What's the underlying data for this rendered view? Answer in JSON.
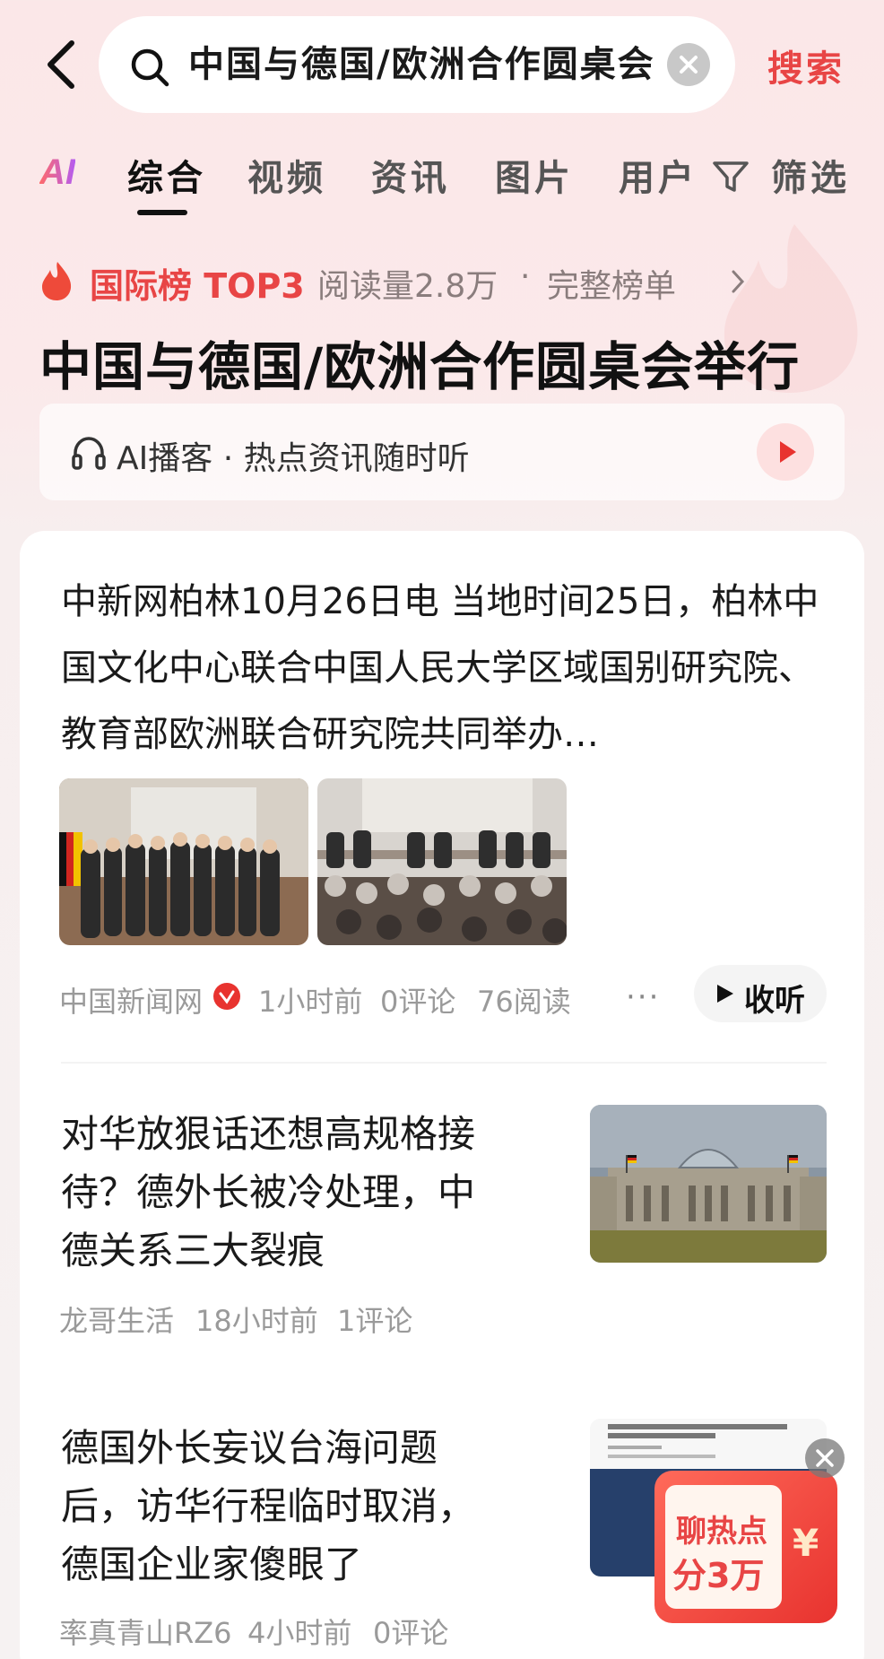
{
  "search": {
    "query": "中国与德国/欧洲合作圆桌会",
    "submit_label": "搜索"
  },
  "tabs": {
    "ai_label": "AI",
    "items": [
      "综合",
      "视频",
      "资讯",
      "图片",
      "用户"
    ],
    "filter_label": "筛选"
  },
  "hot": {
    "rank_label": "国际榜 TOP3",
    "read_count": "阅读量2.8万",
    "separator": "·",
    "full_list": "完整榜单",
    "title": "中国与德国/欧洲合作圆桌会举行",
    "podcast_text": "AI播客 · 热点资讯随时听"
  },
  "articles": [
    {
      "text": "中新网柏林10月26日电 当地时间25日，柏林中国文化中心联合中国人民大学区域国别研究院、教育部欧洲联合研究院共同举办…",
      "source": "中国新闻网",
      "time": "1小时前",
      "comments": "0评论",
      "reads": "76阅读",
      "more": "···",
      "listen_label": "收听"
    },
    {
      "text": "对华放狠话还想高规格接待？德外长被冷处理，中德关系三大裂痕",
      "source": "龙哥生活",
      "time": "18小时前",
      "comments": "1评论"
    },
    {
      "text": "德国外长妄议台海问题后，访华行程临时取消，德国企业家傻眼了",
      "source": "率真青山RZ6",
      "time": "4小时前",
      "comments": "0评论"
    }
  ],
  "promo": {
    "line1": "聊热点",
    "line2": "分3万",
    "currency": "¥"
  },
  "colors": {
    "accent_red": "#e84545",
    "meta_gray": "#9a9a9a",
    "background_pink": "#fbe7e8"
  }
}
